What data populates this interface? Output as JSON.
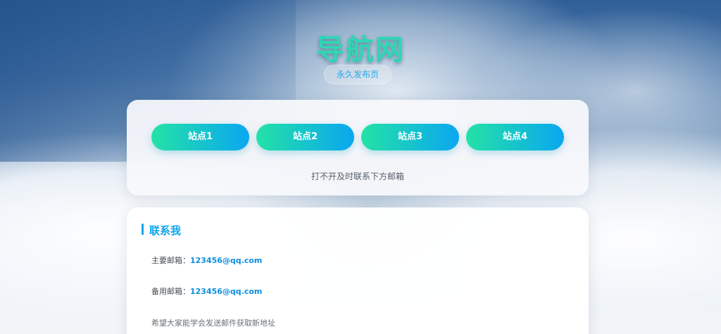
{
  "header": {
    "title": "导航网",
    "subtitle": "永久发布页"
  },
  "sites": {
    "buttons": [
      {
        "label": "站点1"
      },
      {
        "label": "站点2"
      },
      {
        "label": "站点3"
      },
      {
        "label": "站点4"
      }
    ],
    "notice": "打不开及时联系下方邮箱"
  },
  "contact": {
    "heading": "联系我",
    "primary_label": "主要邮箱：",
    "primary_email": "123456@qq.com",
    "backup_label": "备用邮箱：",
    "backup_email": "123456@qq.com",
    "hint": "希望大家能学会发送邮件获取新地址"
  },
  "colors": {
    "accent": "#0ba6ee",
    "button_gradient_start": "#23e2a6",
    "button_gradient_end": "#0aa7f0",
    "title": "#2fd6b3"
  }
}
